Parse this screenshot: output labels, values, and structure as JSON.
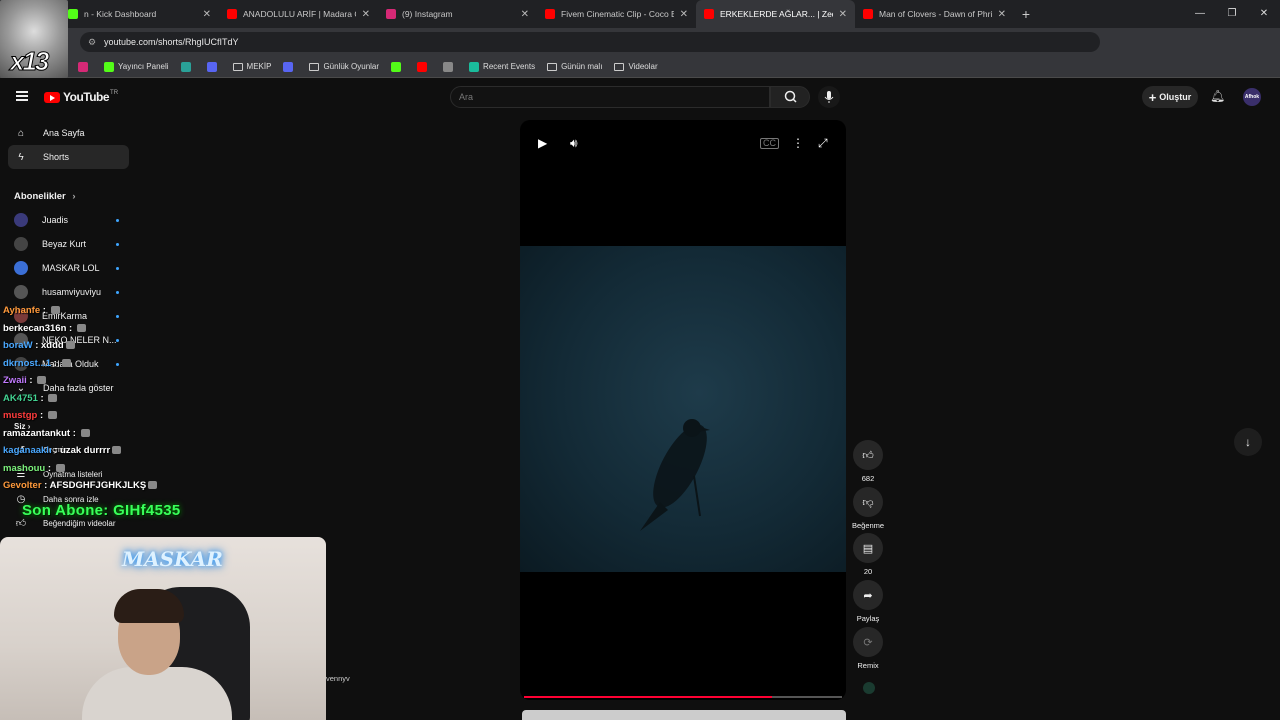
{
  "browser": {
    "tabs": [
      {
        "title": "n - Kick Dashboard",
        "favicon_color": "#53fc18",
        "active": false
      },
      {
        "title": "ANADOLULU ARİF | Madara Ol",
        "favicon_color": "#ff0000",
        "active": false
      },
      {
        "title": "(9) Instagram",
        "favicon_color": "#d62976",
        "active": false
      },
      {
        "title": "Fivem Cinematic Clip - Coco Be",
        "favicon_color": "#ff0000",
        "active": false
      },
      {
        "title": "ERKEKLERDE AĞLAR... | Zed Ku",
        "favicon_color": "#ff0000",
        "active": true
      },
      {
        "title": "Man of Clovers - Dawn of Phri",
        "favicon_color": "#ff0000",
        "active": false
      }
    ],
    "url": "youtube.com/shorts/RhgIUCfITdY",
    "bookmarks": [
      {
        "label": "",
        "icon": "instagram-icon",
        "color": "#d62976"
      },
      {
        "label": "Yayıncı Paneli",
        "icon": "kick-icon",
        "color": "#53fc18"
      },
      {
        "label": "",
        "icon": "app-icon",
        "color": "#2aa198"
      },
      {
        "label": "",
        "icon": "arrow-icon",
        "color": "#5865f2"
      },
      {
        "label": "MEKİP",
        "icon": "folder-icon",
        "color": "#cccccc"
      },
      {
        "label": "",
        "icon": "discord-icon",
        "color": "#5865f2"
      },
      {
        "label": "Günlük Oyunlar",
        "icon": "folder-icon",
        "color": "#cccccc"
      },
      {
        "label": "",
        "icon": "kick-icon",
        "color": "#53fc18"
      },
      {
        "label": "",
        "icon": "youtube-icon",
        "color": "#ff0000"
      },
      {
        "label": "",
        "icon": "globe-icon",
        "color": "#888888"
      },
      {
        "label": "Recent Events",
        "icon": "events-icon",
        "color": "#1abc9c"
      },
      {
        "label": "Günün malı",
        "icon": "folder-icon",
        "color": "#cccccc"
      },
      {
        "label": "Videolar",
        "icon": "folder-icon",
        "color": "#cccccc"
      }
    ]
  },
  "youtube": {
    "logo_text": "YouTube",
    "region": "TR",
    "search_placeholder": "Ara",
    "create_label": "Oluştur",
    "avatar_text": "Afhok"
  },
  "sidebar": {
    "home": "Ana Sayfa",
    "shorts": "Shorts",
    "subscriptions_header": "Abonelikler",
    "subscriptions": [
      {
        "name": "Juadis",
        "color": "#3a3a7a"
      },
      {
        "name": "Beyaz Kurt",
        "color": "#444444"
      },
      {
        "name": "MASKAR LOL",
        "color": "#3b6fd6"
      },
      {
        "name": "husamviyuviyu",
        "color": "#555555"
      },
      {
        "name": "EmirKarma",
        "color": "#7a3a3a"
      },
      {
        "name": "NEKO NELER N...",
        "color": "#555555"
      },
      {
        "name": "Madara Olduk",
        "color": "#444444"
      }
    ],
    "show_more": "Daha fazla göster",
    "you_header": "Siz",
    "history": "Geçmiş",
    "playlists": "Oynatma listeleri",
    "watch_later": "Daha sonra izle",
    "liked": "Beğendiğim videolar"
  },
  "video": {
    "progress_percent": 78
  },
  "actions": {
    "like_count": "682",
    "dislike_label": "Beğenme",
    "comment_count": "20",
    "share_label": "Paylaş",
    "remix_label": "Remix"
  },
  "overlay": {
    "catcam_text": "x13",
    "chat": [
      {
        "user": "Ayhanfe",
        "msg": "",
        "color": "#ff9a3c"
      },
      {
        "user": "berkecan316n",
        "msg": "",
        "color": "#ffffff"
      },
      {
        "user": "boraW",
        "msg": "xddd",
        "color": "#4aa8ff"
      },
      {
        "user": "dkrnost...1",
        "msg": "",
        "color": "#4aa8ff"
      },
      {
        "user": "Zwaii",
        "msg": "",
        "color": "#c27bff"
      },
      {
        "user": "AK4751",
        "msg": "",
        "color": "#42d392"
      },
      {
        "user": "mustgp",
        "msg": "",
        "color": "#ff3c3c"
      },
      {
        "user": "ramazantankut",
        "msg": "",
        "color": "#ffffff"
      },
      {
        "user": "kaganaaklı",
        "msg": "uzak durrrr",
        "color": "#4aa8ff"
      },
      {
        "user": "mashouu",
        "msg": "",
        "color": "#7cf27c"
      },
      {
        "user": "Gevolter",
        "msg": "AFSDGHFJGHKJLKŞ",
        "color": "#ff9a3c"
      }
    ],
    "last_sub": "Son Abone: GIHf4535",
    "webcam_sign": "MASKAR",
    "stray_text": "vennyv"
  }
}
